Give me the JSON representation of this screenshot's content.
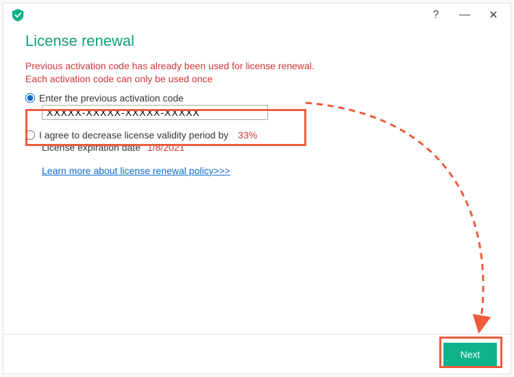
{
  "colors": {
    "accent": "#0fb28a",
    "danger": "#d13438",
    "link": "#0b6bcb",
    "highlight": "#ef5a3b"
  },
  "titlebar": {
    "help_glyph": "?",
    "minimize_glyph": "—",
    "close_glyph": "✕"
  },
  "header": {
    "title": "License renewal"
  },
  "error": {
    "line1": "Previous activation code has already been used for license renewal.",
    "line2": "Each activation code can only be used once"
  },
  "options": {
    "enter_code": {
      "label": "Enter the previous activation code",
      "placeholder": "XXXXX-XXXXX-XXXXX-XXXXX",
      "value": "XXXXX-XXXXX-XXXXX-XXXXX",
      "selected": true
    },
    "decrease": {
      "label": "I agree to decrease license validity period by",
      "percent": "33%",
      "expiration_label": "License expiration date",
      "expiration_date": "1/8/2021",
      "selected": false
    }
  },
  "link": {
    "text": "Learn more about license renewal policy>>>"
  },
  "footer": {
    "next_label": "Next"
  }
}
